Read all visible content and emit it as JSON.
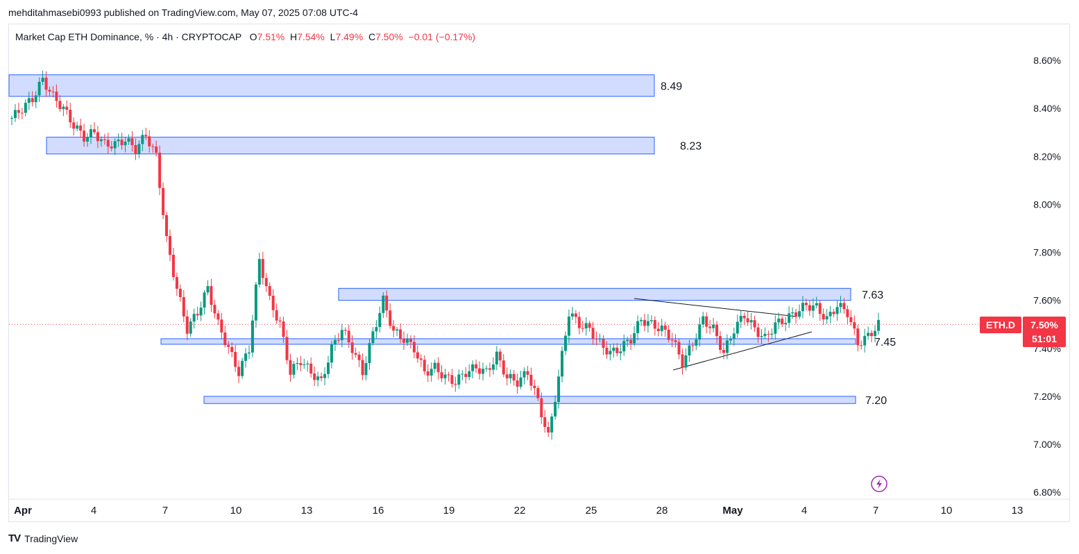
{
  "header": {
    "publisher_line": "mehditahmasebi0993 published on TradingView.com, May 07, 2025 07:08 UTC-4"
  },
  "legend": {
    "symbol_line": "Market Cap ETH Dominance, % · 4h · CRYPTOCAP",
    "open_label": "O",
    "open": "7.51%",
    "high_label": "H",
    "high": "7.54%",
    "low_label": "L",
    "low": "7.49%",
    "close_label": "C",
    "close": "7.50%",
    "change": "−0.01 (−0.17%)"
  },
  "price_tag": {
    "symbol": "ETH.D",
    "price": "7.50%",
    "countdown": "51:01"
  },
  "footer": {
    "brand": "TradingView",
    "logo_text": "TV"
  },
  "colors": {
    "up": "#089981",
    "down": "#f23645",
    "zone_fill": "#d1dcff",
    "zone_stroke": "#2962ff",
    "accent_purple": "#9c27b0"
  },
  "chart_data": {
    "type": "candlestick",
    "timeframe": "4h",
    "y_axis": {
      "ticks": [
        "8.60%",
        "8.40%",
        "8.20%",
        "8.00%",
        "7.80%",
        "7.60%",
        "7.40%",
        "7.20%",
        "7.00%",
        "6.80%"
      ],
      "ylim": [
        6.78,
        8.68
      ]
    },
    "x_axis": {
      "ticks": [
        "Apr",
        "4",
        "7",
        "10",
        "13",
        "16",
        "19",
        "22",
        "25",
        "28",
        "May",
        "4",
        "7",
        "10",
        "13"
      ]
    },
    "current_price": 7.5,
    "zones": [
      {
        "label": "8.49",
        "x_start": "Apr 1",
        "x_end": "Apr 28",
        "top": 8.54,
        "bottom": 8.45
      },
      {
        "label": "8.23",
        "x_start": "Apr 2",
        "x_end": "Apr 28",
        "top": 8.28,
        "bottom": 8.21
      },
      {
        "label": "7.63",
        "x_start": "Apr 14",
        "x_end": "May 6",
        "top": 7.65,
        "bottom": 7.6
      },
      {
        "label": "7.45",
        "x_start": "Apr 7",
        "x_end": "May 6",
        "top": 7.44,
        "bottom": 7.42
      },
      {
        "label": "7.20",
        "x_start": "Apr 9",
        "x_end": "May 6",
        "top": 7.2,
        "bottom": 7.17
      }
    ],
    "trendlines": [
      {
        "from": [
          "Apr 26",
          7.61
        ],
        "to": [
          "May 3",
          7.54
        ]
      },
      {
        "from": [
          "Apr 28",
          7.31
        ],
        "to": [
          "May 4",
          7.48
        ]
      }
    ],
    "candles_close_path": [
      [
        "Apr 1",
        8.36
      ],
      [
        "Apr 1",
        8.4
      ],
      [
        "Apr 1",
        8.44
      ],
      [
        "Apr 2",
        8.52
      ],
      [
        "Apr 2",
        8.45
      ],
      [
        "Apr 2",
        8.4
      ],
      [
        "Apr 3",
        8.33
      ],
      [
        "Apr 3",
        8.28
      ],
      [
        "Apr 4",
        8.3
      ],
      [
        "Apr 4",
        8.25
      ],
      [
        "Apr 5",
        8.25
      ],
      [
        "Apr 5",
        8.27
      ],
      [
        "Apr 6",
        8.23
      ],
      [
        "Apr 6",
        8.29
      ],
      [
        "Apr 6",
        8.2
      ],
      [
        "Apr 7",
        7.85
      ],
      [
        "Apr 7",
        7.65
      ],
      [
        "Apr 7",
        7.48
      ],
      [
        "Apr 8",
        7.55
      ],
      [
        "Apr 8",
        7.65
      ],
      [
        "Apr 8",
        7.5
      ],
      [
        "Apr 9",
        7.4
      ],
      [
        "Apr 9",
        7.3
      ],
      [
        "Apr 9",
        7.4
      ],
      [
        "Apr 10",
        7.77
      ],
      [
        "Apr 10",
        7.6
      ],
      [
        "Apr 10",
        7.5
      ],
      [
        "Apr 11",
        7.3
      ],
      [
        "Apr 11",
        7.35
      ],
      [
        "Apr 12",
        7.3
      ],
      [
        "Apr 12",
        7.26
      ],
      [
        "Apr 13",
        7.4
      ],
      [
        "Apr 13",
        7.48
      ],
      [
        "Apr 13",
        7.4
      ],
      [
        "Apr 14",
        7.3
      ],
      [
        "Apr 14",
        7.46
      ],
      [
        "Apr 14",
        7.6
      ],
      [
        "Apr 15",
        7.47
      ],
      [
        "Apr 15",
        7.44
      ],
      [
        "Apr 16",
        7.4
      ],
      [
        "Apr 16",
        7.3
      ],
      [
        "Apr 17",
        7.32
      ],
      [
        "Apr 17",
        7.28
      ],
      [
        "Apr 18",
        7.26
      ],
      [
        "Apr 18",
        7.3
      ],
      [
        "Apr 19",
        7.32
      ],
      [
        "Apr 19",
        7.3
      ],
      [
        "Apr 20",
        7.37
      ],
      [
        "Apr 20",
        7.28
      ],
      [
        "Apr 21",
        7.26
      ],
      [
        "Apr 21",
        7.3
      ],
      [
        "Apr 21",
        7.18
      ],
      [
        "Apr 22",
        7.03
      ],
      [
        "Apr 22",
        7.28
      ],
      [
        "Apr 22",
        7.55
      ],
      [
        "Apr 23",
        7.5
      ],
      [
        "Apr 23",
        7.48
      ],
      [
        "Apr 24",
        7.42
      ],
      [
        "Apr 24",
        7.38
      ],
      [
        "Apr 25",
        7.4
      ],
      [
        "Apr 25",
        7.44
      ],
      [
        "Apr 26",
        7.52
      ],
      [
        "Apr 26",
        7.5
      ],
      [
        "Apr 27",
        7.48
      ],
      [
        "Apr 27",
        7.44
      ],
      [
        "Apr 28",
        7.34
      ],
      [
        "Apr 28",
        7.42
      ],
      [
        "Apr 29",
        7.52
      ],
      [
        "Apr 29",
        7.48
      ],
      [
        "Apr 30",
        7.38
      ],
      [
        "Apr 30",
        7.48
      ],
      [
        "May 1",
        7.54
      ],
      [
        "May 1",
        7.48
      ],
      [
        "May 2",
        7.44
      ],
      [
        "May 2",
        7.5
      ],
      [
        "May 3",
        7.52
      ],
      [
        "May 3",
        7.55
      ],
      [
        "May 4",
        7.58
      ],
      [
        "May 4",
        7.57
      ],
      [
        "May 5",
        7.52
      ],
      [
        "May 5",
        7.58
      ],
      [
        "May 6",
        7.55
      ],
      [
        "May 6",
        7.42
      ],
      [
        "May 7",
        7.45
      ],
      [
        "May 7",
        7.5
      ]
    ]
  }
}
